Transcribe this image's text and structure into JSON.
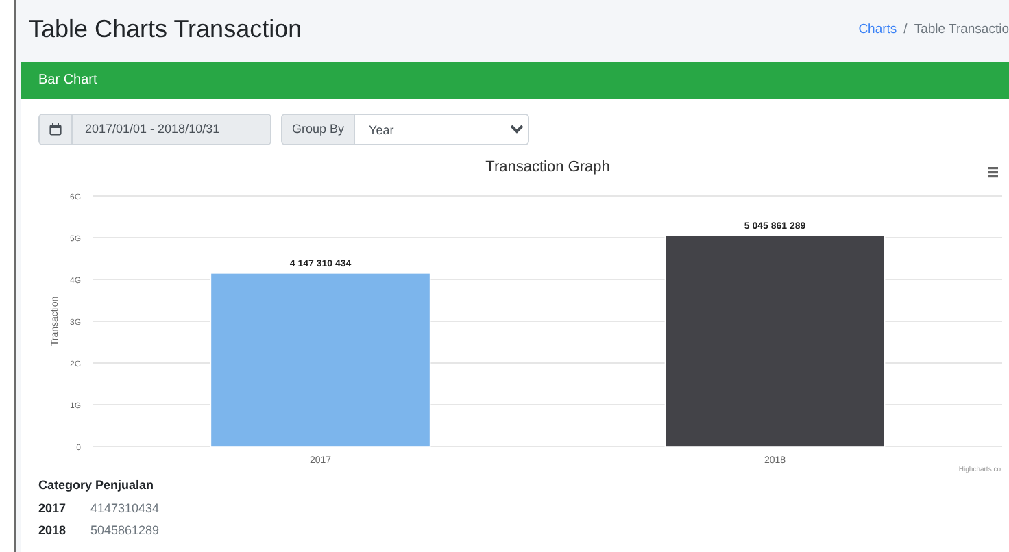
{
  "page_title": "Table Charts Transaction",
  "breadcrumb": [
    {
      "label": "Charts",
      "kind": "link"
    },
    {
      "label": "/",
      "kind": "separator"
    },
    {
      "label": "Table Transactio",
      "kind": "current"
    }
  ],
  "card": {
    "title": "Bar Chart",
    "date_range": {
      "value": "2017/01/01 - 2018/10/31"
    },
    "group_by": {
      "label": "Group By",
      "value": "Year"
    },
    "chart_data": {
      "type": "bar",
      "title": "Transaction Graph",
      "ylabel": "Transaction",
      "categories": [
        "2017",
        "2018"
      ],
      "series": [
        {
          "color": "#7cb5ec",
          "values": [
            4.15,
            null
          ]
        },
        {
          "color": "#434348",
          "values": [
            null,
            5.05
          ]
        }
      ],
      "ylim": [
        0,
        6
      ],
      "grid": true,
      "yticks": [
        {
          "value": 0,
          "label": "0"
        },
        {
          "value": 1,
          "label": "1G"
        },
        {
          "value": 2,
          "label": "2G"
        },
        {
          "value": 3,
          "label": "3G"
        },
        {
          "value": 4,
          "label": "4G"
        },
        {
          "value": 5,
          "label": "5G"
        },
        {
          "value": 6,
          "label": "6G"
        }
      ],
      "value_labels": [
        "4 147 310 434",
        "5 045 861 289"
      ],
      "annotations": [
        {
          "text": "Highcharts.co"
        }
      ]
    },
    "table": {
      "title": "Category Penjualan",
      "rows": [
        {
          "category": "2017",
          "value": "4147310434"
        },
        {
          "category": "2018",
          "value": "5045861289"
        }
      ]
    }
  }
}
